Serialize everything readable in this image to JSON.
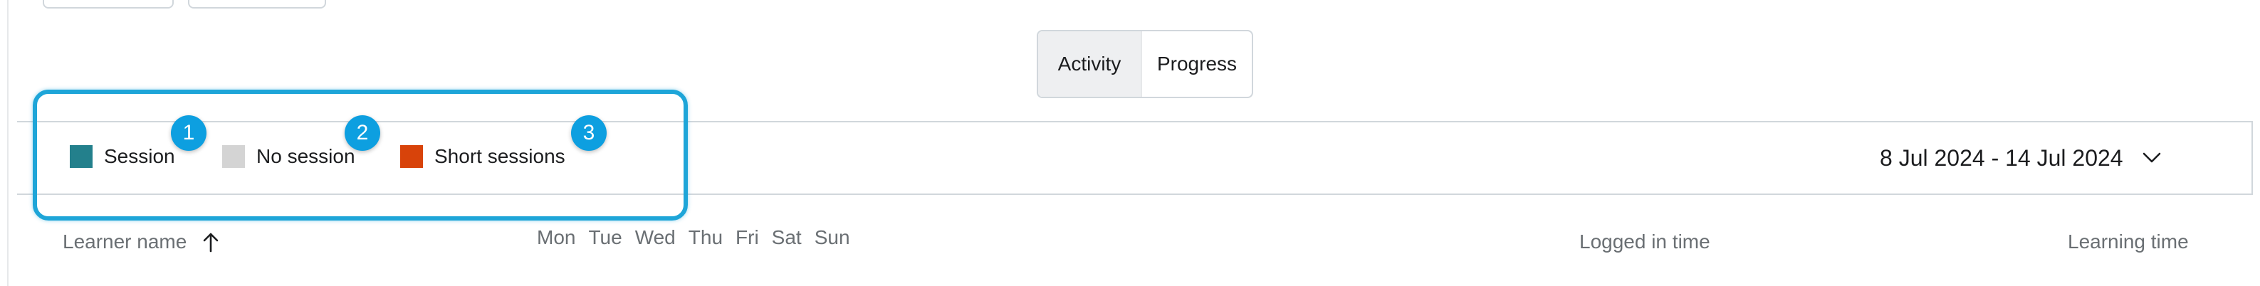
{
  "tabs": [
    {
      "label": "Activity",
      "active": true
    },
    {
      "label": "Progress",
      "active": false
    }
  ],
  "legend": [
    {
      "label": "Session",
      "color": "#23808c"
    },
    {
      "label": "No session",
      "color": "#d4d4d4"
    },
    {
      "label": "Short sessions",
      "color": "#d8430a"
    }
  ],
  "badges": [
    "1",
    "2",
    "3"
  ],
  "date_range": {
    "label": "8 Jul 2024 - 14 Jul 2024"
  },
  "table_header": {
    "learner_name": "Learner name",
    "days": [
      "Mon",
      "Tue",
      "Wed",
      "Thu",
      "Fri",
      "Sat",
      "Sun"
    ],
    "logged_in_time": "Logged in time",
    "learning_time": "Learning time"
  },
  "colors": {
    "highlight": "#1ea5d8",
    "badge": "#0d9fe0"
  }
}
